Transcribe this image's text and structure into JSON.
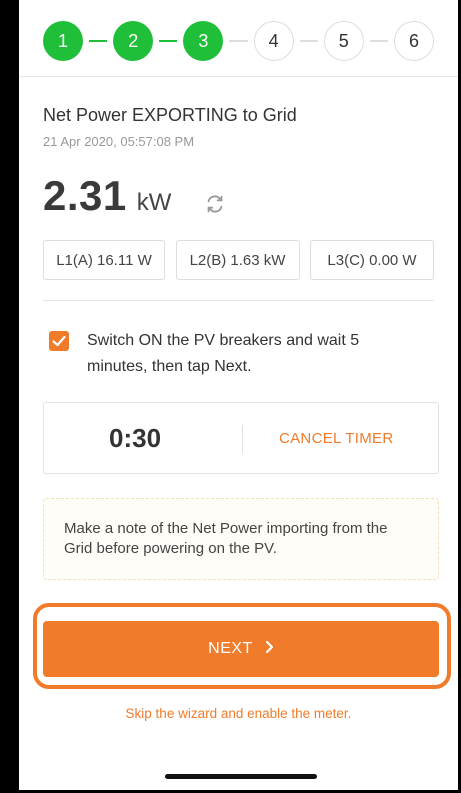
{
  "stepper": {
    "steps": [
      {
        "label": "1",
        "state": "done"
      },
      {
        "label": "2",
        "state": "done"
      },
      {
        "label": "3",
        "state": "done"
      },
      {
        "label": "4",
        "state": "todo"
      },
      {
        "label": "5",
        "state": "todo"
      },
      {
        "label": "6",
        "state": "todo"
      }
    ],
    "done_color": "#1fbf3a"
  },
  "status": {
    "title": "Net Power EXPORTING to Grid",
    "timestamp": "21 Apr 2020, 05:57:08 PM",
    "power_value": "2.31",
    "power_unit": "kW",
    "refresh_icon": "refresh-icon"
  },
  "phases": [
    {
      "label": "L1(A) 16.11 W"
    },
    {
      "label": "L2(B) 1.63 kW"
    },
    {
      "label": "L3(C) 0.00 W"
    }
  ],
  "checklist": {
    "checked": true,
    "text": "Switch ON the PV breakers and wait 5 minutes, then tap Next."
  },
  "timer": {
    "value": "0:30",
    "cancel_label": "CANCEL TIMER"
  },
  "note": {
    "text": "Make a note of the Net Power importing from the Grid before powering on the PV."
  },
  "actions": {
    "next_label": "NEXT",
    "skip_label": "Skip the wizard and enable the meter."
  },
  "colors": {
    "accent": "#f07b2b",
    "success": "#1fbf3a"
  }
}
